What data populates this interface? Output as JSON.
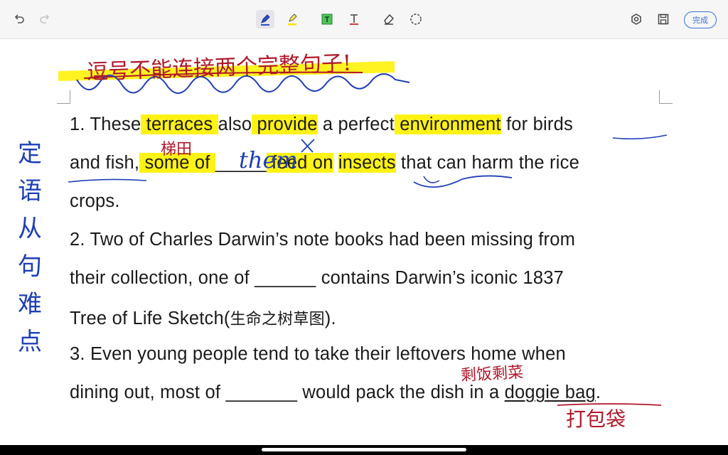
{
  "toolbar": {
    "done_label": "完成"
  },
  "annotations": {
    "top_note": "逗号不能连接两个完整句子!",
    "side_note": [
      "定",
      "语",
      "从",
      "句",
      "难",
      "点"
    ],
    "terraces_note": "梯田",
    "pronoun_fill": "them",
    "leftovers_note": "剩饭剩菜",
    "doggie_bag_note": "打包袋"
  },
  "document": {
    "q1": {
      "a": "1. These",
      "terraces": " terraces ",
      "b": "also",
      "provide": " provide",
      "c": " a perfect",
      "environment": " environment",
      "d": " for ",
      "birds": "birds",
      "line2_a": "and fish,",
      "some_of": " some of ",
      "blank": "_____",
      "feed_on": " feed on",
      "sp": " ",
      "insects": "insects",
      "line2_b": " that can harm the rice",
      "line3": "crops."
    },
    "q2": {
      "line1": "2. Two of Charles Darwin’s note books had been missing from",
      "line2": "their collection, one of ______ contains Darwin’s iconic 1837",
      "line3_a": "Tree of Life Sketch(",
      "line3_cn": "生命之树草图",
      "line3_b": ")."
    },
    "q3": {
      "line1": "3. Even young people tend to take their leftovers home when",
      "line2_a": "dining out, most of _______ would pack the dish in a ",
      "doggie_bag": "doggie bag",
      "line2_b": "."
    }
  },
  "colors": {
    "highlight": "#fff215",
    "pen_blue": "#1f3fb5",
    "pen_red": "#b0172a",
    "accent": "#3a70d9"
  },
  "icons": [
    "undo-icon",
    "redo-icon",
    "pen-icon",
    "highlighter-icon",
    "text-box-icon",
    "text-cursor-icon",
    "eraser-icon",
    "lasso-icon",
    "settings-icon",
    "save-icon"
  ]
}
